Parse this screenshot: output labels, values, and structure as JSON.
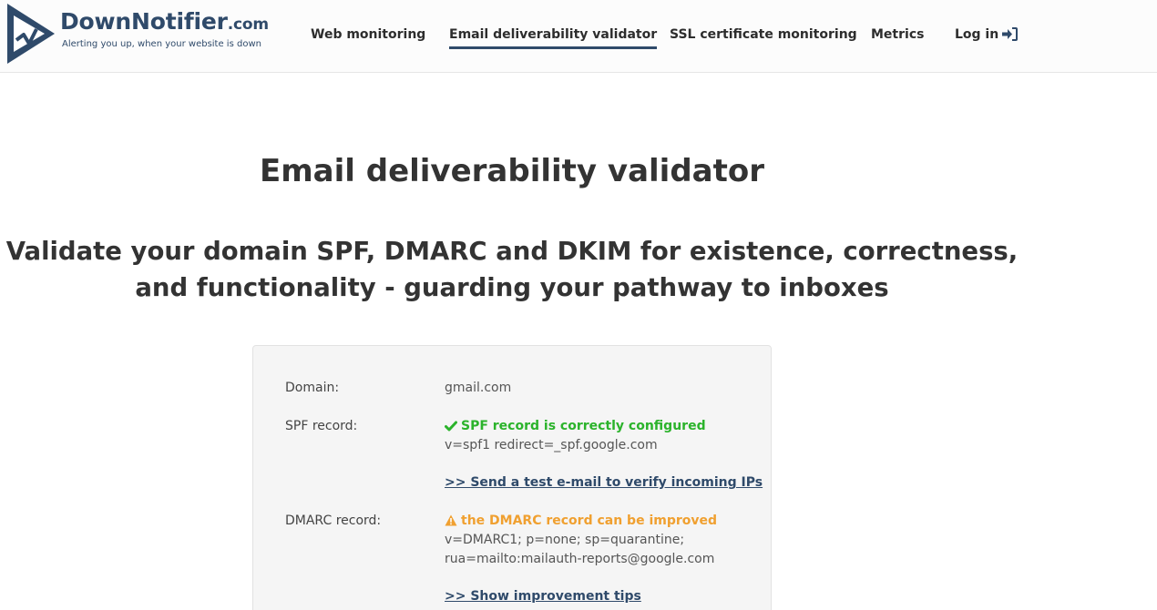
{
  "header": {
    "logo": {
      "name": "DownNotifier",
      "domain_suffix": ".com",
      "tagline": "Alerting you up, when your website is down"
    },
    "nav": [
      {
        "label": "Web monitoring",
        "active": false
      },
      {
        "label": "Email deliverability validator",
        "active": true
      },
      {
        "label": "SSL certificate monitoring",
        "active": false
      },
      {
        "label": "Metrics",
        "active": false
      },
      {
        "label": "Log in",
        "active": false,
        "icon": "sign-in-icon"
      }
    ]
  },
  "main": {
    "title": "Email deliverability validator",
    "subtitle_line1": "Validate your domain SPF, DMARC and DKIM for existence, correctness,",
    "subtitle_line2": "and functionality - guarding your pathway to inboxes"
  },
  "result": {
    "domain": {
      "label": "Domain:",
      "value": "gmail.com"
    },
    "spf": {
      "label": "SPF record:",
      "status": "SPF record is correctly configured",
      "status_icon": "check-icon",
      "status_color": "#2bb32b",
      "record": "v=spf1 redirect=_spf.google.com",
      "link": ">> Send a test e-mail to verify incoming IPs"
    },
    "dmarc": {
      "label": "DMARC record:",
      "status": "the DMARC record can be improved",
      "status_icon": "warning-icon",
      "status_color": "#f0a030",
      "record_line1": "v=DMARC1; p=none; sp=quarantine;",
      "record_line2": "rua=mailto:mailauth-reports@google.com",
      "link": ">> Show improvement tips"
    }
  },
  "colors": {
    "brand": "#2f4a6a",
    "ok": "#2bb32b",
    "warn": "#f0a030"
  }
}
